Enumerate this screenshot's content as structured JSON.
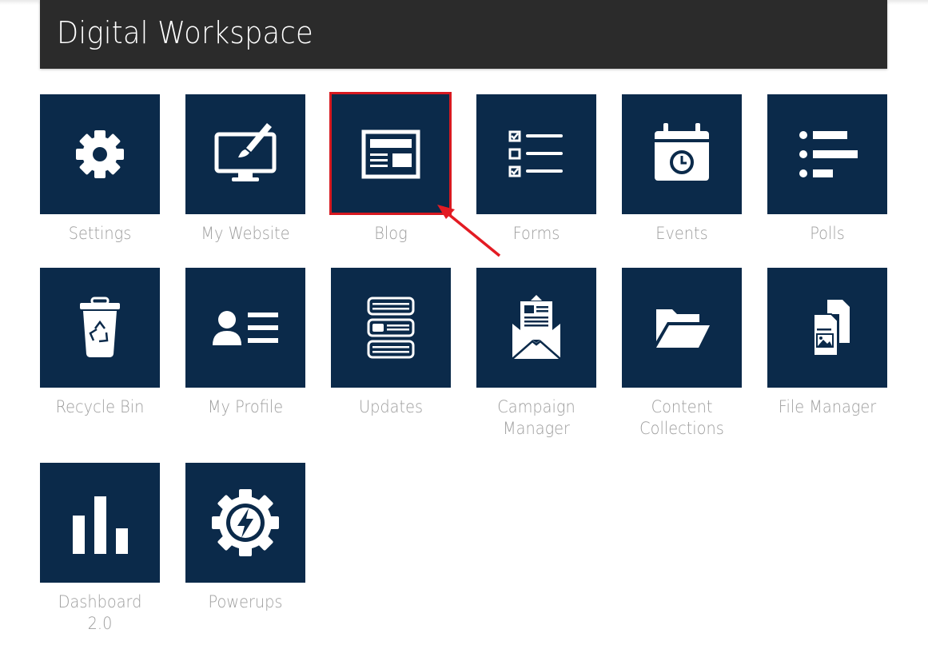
{
  "header": {
    "title": "Digital Workspace"
  },
  "tiles": [
    {
      "label": "Settings",
      "icon": "gear-icon"
    },
    {
      "label": "My Website",
      "icon": "monitor-brush-icon"
    },
    {
      "label": "Blog",
      "icon": "blog-layout-icon"
    },
    {
      "label": "Forms",
      "icon": "checklist-icon"
    },
    {
      "label": "Events",
      "icon": "calendar-clock-icon"
    },
    {
      "label": "Polls",
      "icon": "bar-list-icon"
    },
    {
      "label": "Recycle Bin",
      "icon": "recycle-bin-icon"
    },
    {
      "label": "My Profile",
      "icon": "profile-card-icon"
    },
    {
      "label": "Updates",
      "icon": "stacked-list-icon"
    },
    {
      "label": "Campaign Manager",
      "icon": "envelope-newsletter-icon"
    },
    {
      "label": "Content Collections",
      "icon": "folder-open-icon"
    },
    {
      "label": "File Manager",
      "icon": "files-icon"
    },
    {
      "label": "Dashboard 2.0",
      "icon": "bar-chart-icon"
    },
    {
      "label": "Powerups",
      "icon": "gear-lightning-icon"
    }
  ],
  "colors": {
    "header_bg": "#2b2b2b",
    "tile_bg": "#0b2a4a",
    "label_text": "#9e9e9e",
    "highlight": "#d71920"
  }
}
